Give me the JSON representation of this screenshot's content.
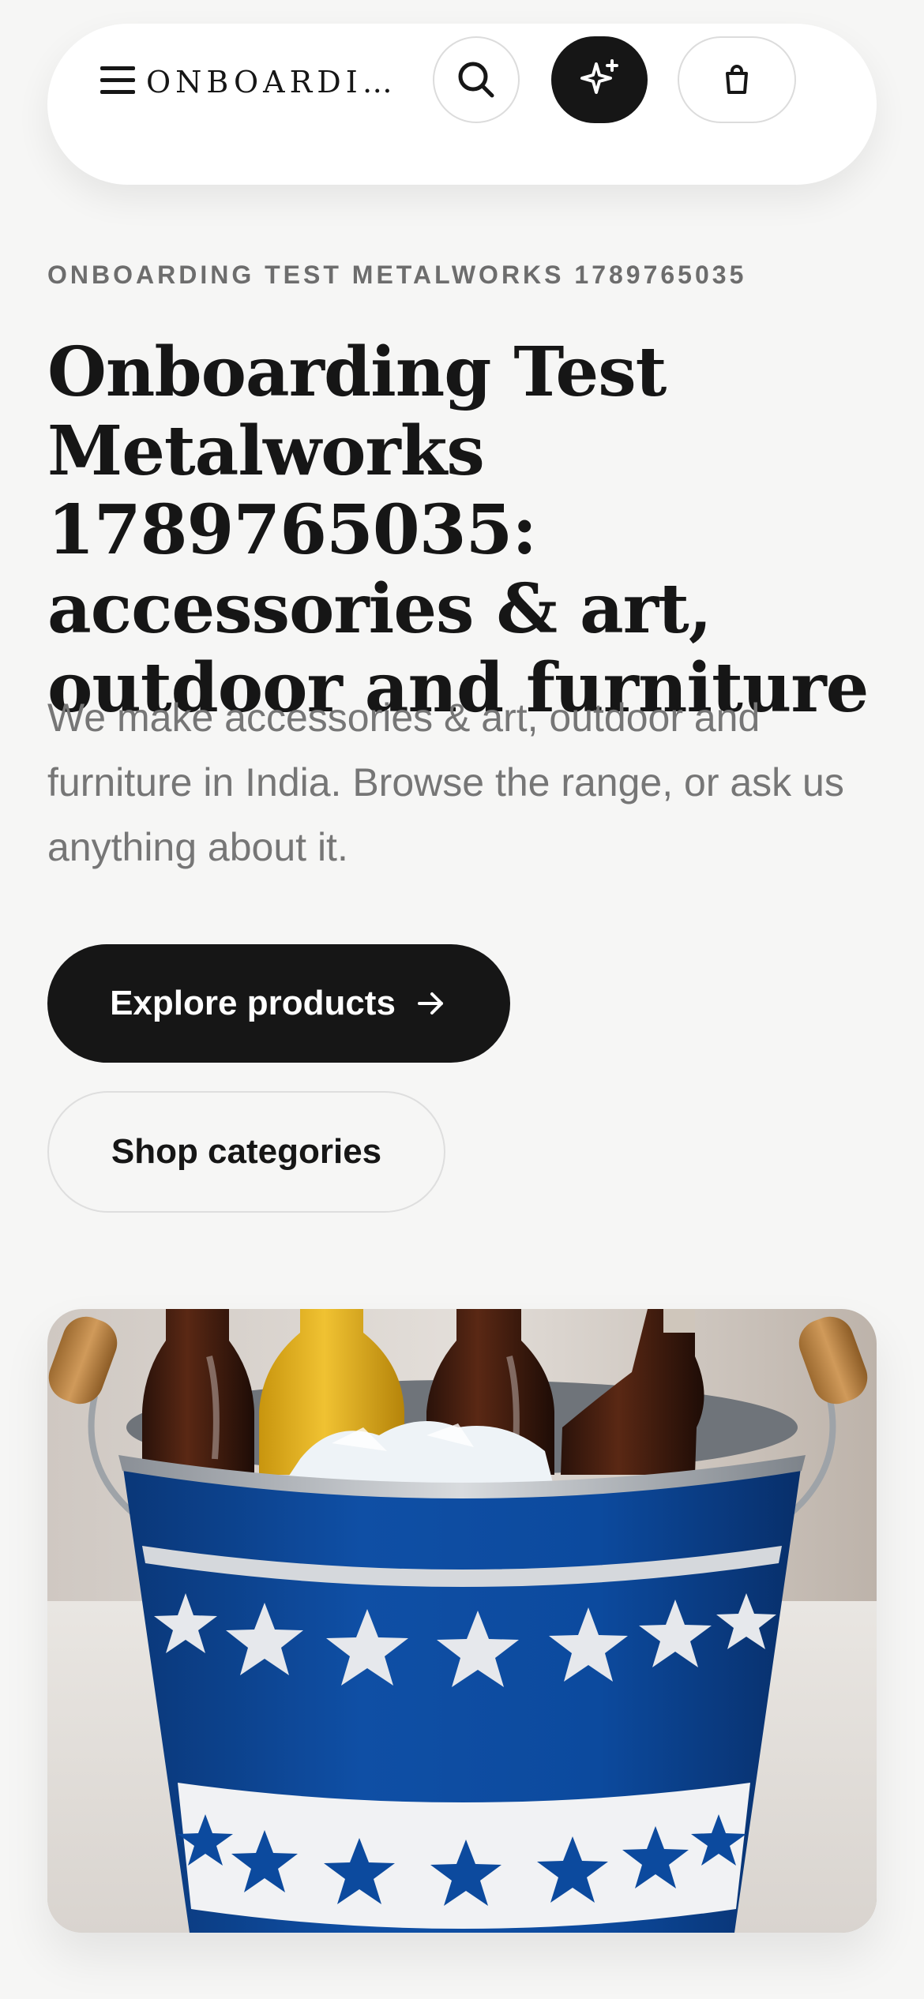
{
  "header": {
    "brand": "ONBOARDI…",
    "menu_icon": "hamburger-menu-icon",
    "search_icon": "search-icon",
    "ai_icon": "sparkles-icon",
    "cart_icon": "shopping-bag-icon"
  },
  "hero": {
    "eyebrow": "ONBOARDING TEST METALWORKS 1789765035",
    "headline": "Onboarding Test Metalworks 1789765035: accessories & art, outdoor and furniture",
    "lede": "We make accessories & art, outdoor and furniture in India. Browse the range, or ask us anything about it.",
    "primary_cta": "Explore products",
    "primary_cta_icon": "arrow-right-icon",
    "secondary_cta": "Shop categories"
  },
  "image": {
    "subject": "blue metal ice bucket with white stars holding bottles on ice"
  },
  "colors": {
    "background": "#f6f6f5",
    "primary": "#161616",
    "bucket_blue": "#0c4a9e"
  }
}
